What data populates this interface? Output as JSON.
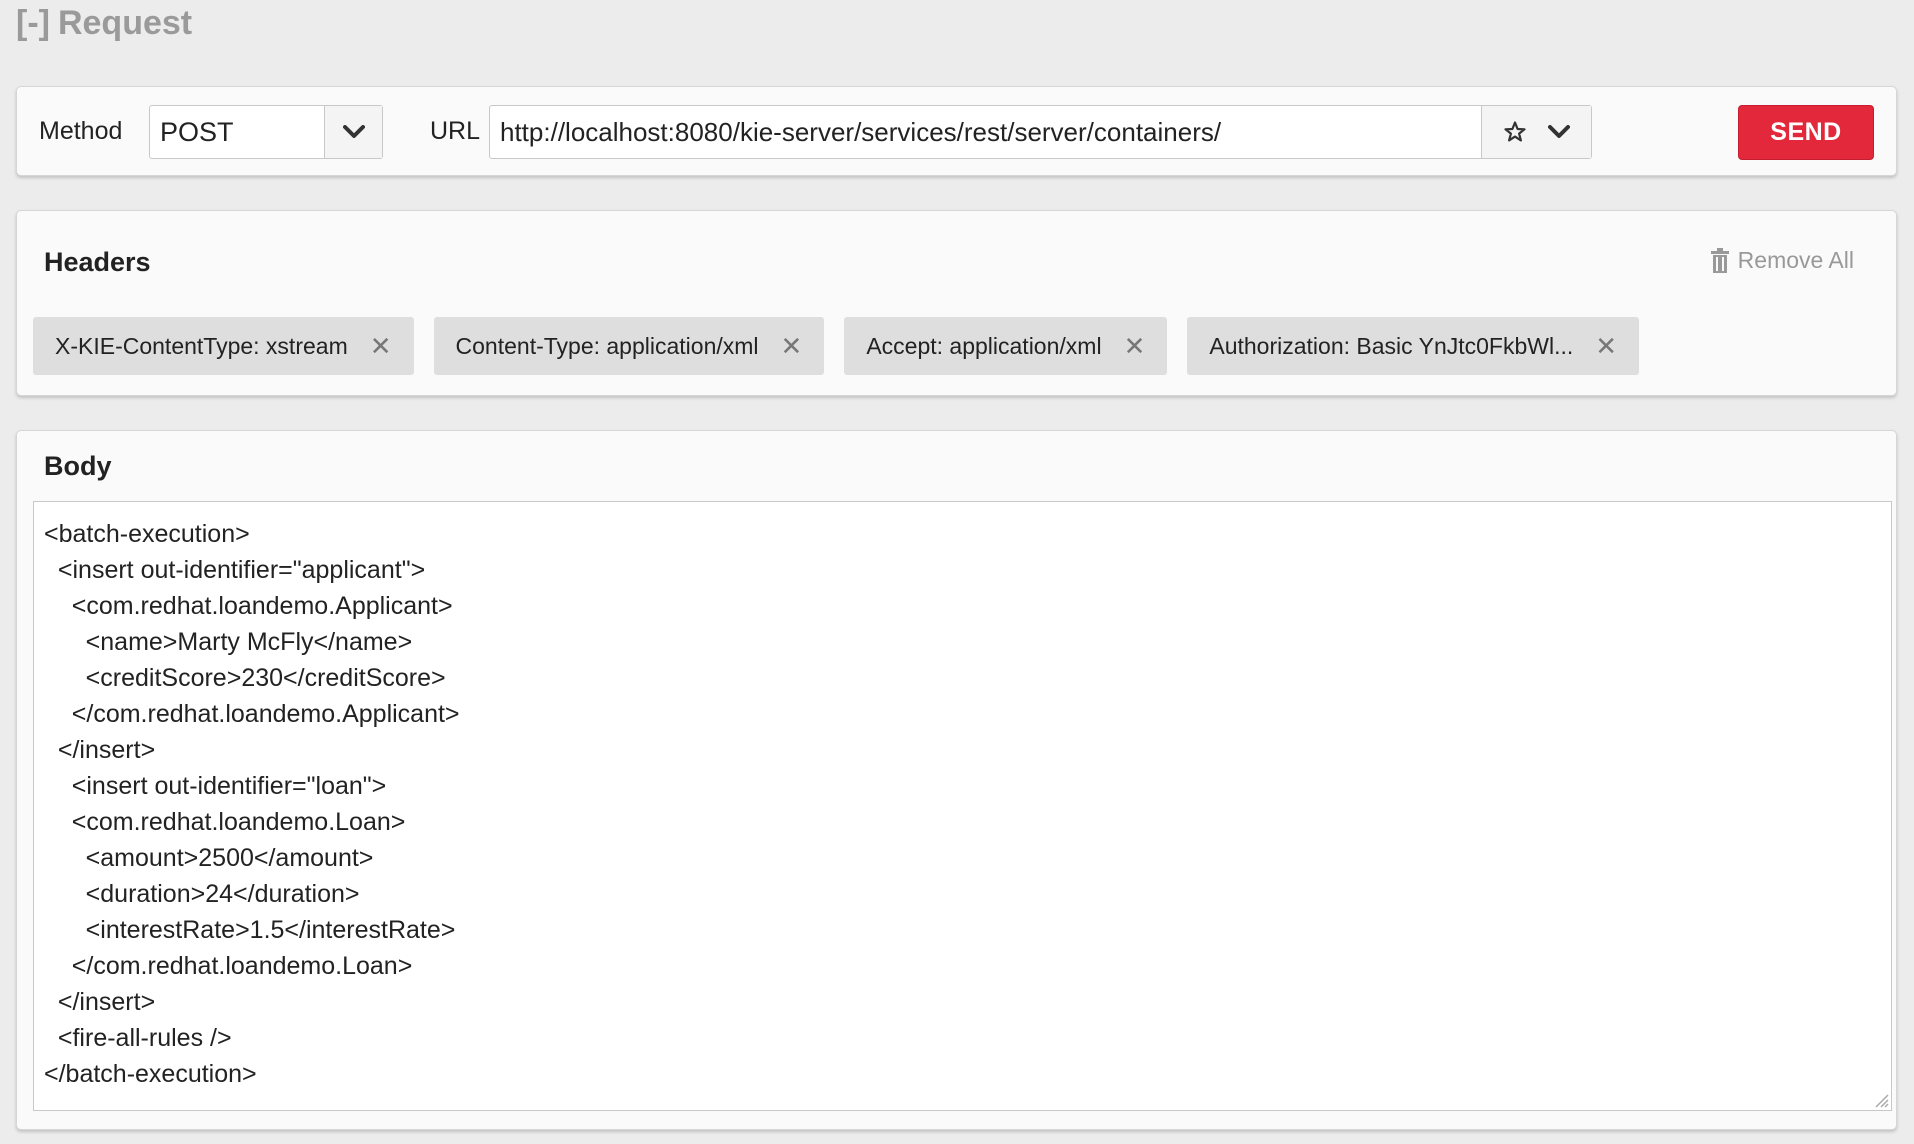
{
  "section": {
    "toggle": "[-]",
    "title": "Request"
  },
  "request": {
    "method_label": "Method",
    "method_value": "POST",
    "url_label": "URL",
    "url_value": "http://localhost:8080/kie-server/services/rest/server/containers/",
    "send_label": "SEND"
  },
  "headers": {
    "title": "Headers",
    "remove_all_label": "Remove All",
    "items": [
      {
        "label": "X-KIE-ContentType: xstream"
      },
      {
        "label": "Content-Type: application/xml"
      },
      {
        "label": "Accept: application/xml"
      },
      {
        "label": "Authorization: Basic YnJtc0FkbWl..."
      }
    ],
    "close_glyph": "✕"
  },
  "body": {
    "title": "Body",
    "content": "<batch-execution>\n  <insert out-identifier=\"applicant\">\n    <com.redhat.loandemo.Applicant>\n      <name>Marty McFly</name>\n      <creditScore>230</creditScore>\n    </com.redhat.loandemo.Applicant>\n  </insert>\n    <insert out-identifier=\"loan\">\n    <com.redhat.loandemo.Loan>\n      <amount>2500</amount>\n      <duration>24</duration>\n      <interestRate>1.5</interestRate>\n    </com.redhat.loandemo.Loan>\n  </insert>\n  <fire-all-rules />\n</batch-execution>"
  },
  "icons": {
    "method_dropdown": "chevron-down-icon",
    "favorite": "star-icon",
    "url_dropdown": "chevron-down-icon",
    "remove_all": "trash-icon",
    "chip_close": "close-icon",
    "resize": "resize-handle-icon"
  },
  "colors": {
    "send_button": "#e3283b",
    "background": "#ececec",
    "chip_background": "#dedede",
    "muted_text": "#9a9a9a"
  }
}
